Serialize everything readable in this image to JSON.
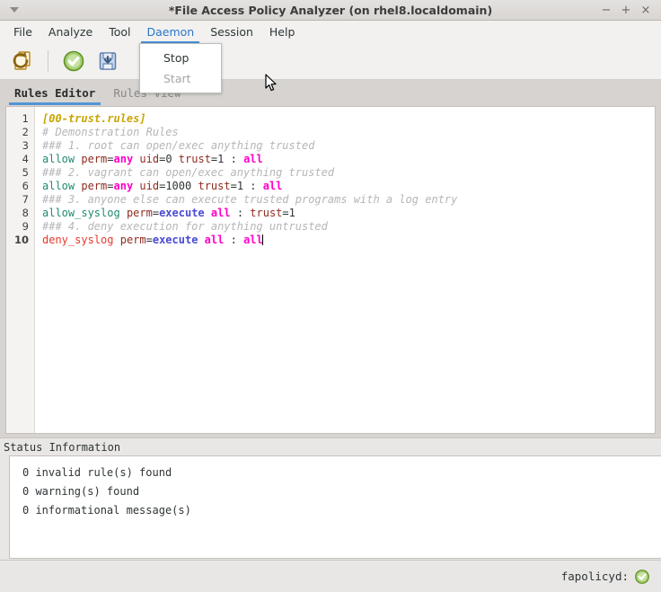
{
  "window": {
    "title": "*File Access Policy Analyzer (on rhel8.localdomain)",
    "menu_arrow_icon": "triangle-down-icon",
    "minimize_label": "−",
    "maximize_label": "+",
    "close_label": "×"
  },
  "menubar": {
    "items": [
      {
        "label": "File",
        "active": false
      },
      {
        "label": "Analyze",
        "active": false
      },
      {
        "label": "Tool",
        "active": false
      },
      {
        "label": "Daemon",
        "active": true
      },
      {
        "label": "Session",
        "active": false
      },
      {
        "label": "Help",
        "active": false
      }
    ]
  },
  "dropdown": {
    "owner": "Daemon",
    "items": [
      {
        "label": "Stop",
        "enabled": true
      },
      {
        "label": "Start",
        "enabled": false
      }
    ]
  },
  "toolbar": {
    "buttons": [
      {
        "name": "refresh-rules-icon",
        "tooltip": "Refresh"
      },
      {
        "name": "check-rules-icon",
        "tooltip": "Validate"
      },
      {
        "name": "save-rules-icon",
        "tooltip": "Save"
      }
    ]
  },
  "tabs": [
    {
      "label": "Rules Editor",
      "active": true
    },
    {
      "label": "Rules View",
      "active": false
    }
  ],
  "editor": {
    "line_numbers": [
      "1",
      "2",
      "3",
      "4",
      "5",
      "6",
      "7",
      "8",
      "9",
      "10"
    ],
    "current_line": 10,
    "lines": [
      {
        "n": 1,
        "plain": "[00-trust.rules]"
      },
      {
        "n": 2,
        "plain": "# Demonstration Rules"
      },
      {
        "n": 3,
        "plain": "### 1. root can open/exec anything trusted"
      },
      {
        "n": 4,
        "plain": "allow perm=any uid=0 trust=1 : all"
      },
      {
        "n": 5,
        "plain": "### 2. vagrant can open/exec anything trusted"
      },
      {
        "n": 6,
        "plain": "allow perm=any uid=1000 trust=1 : all"
      },
      {
        "n": 7,
        "plain": "### 3. anyone else can execute trusted programs with a log entry"
      },
      {
        "n": 8,
        "plain": "allow_syslog perm=execute all : trust=1"
      },
      {
        "n": 9,
        "plain": "### 4. deny execution for anything untrusted"
      },
      {
        "n": 10,
        "plain": "deny_syslog perm=execute all : all"
      }
    ]
  },
  "status_information": {
    "label": "Status Information",
    "messages": [
      "0 invalid rule(s) found",
      "0 warning(s) found",
      "0 informational message(s)"
    ]
  },
  "statusbar": {
    "daemon_label": "fapolicyd:",
    "daemon_state_icon": "green-check-circle-icon"
  },
  "colors": {
    "accent_blue": "#4a90d9",
    "tab_underline": "#5294d6",
    "menu_active_text": "#2a76c6",
    "header_yellow": "#c8a400",
    "comment_grey": "#b6b6b6",
    "allow_teal": "#1f8a70",
    "deny_red": "#e8382a",
    "key_brown": "#8f2b1f",
    "magenta": "#ff00c8",
    "blue_keyword": "#4a4ad6",
    "chrome_bg": "#f2f1f0",
    "tabs_bg": "#d6d3d0",
    "status_bg": "#e9e7e5"
  }
}
